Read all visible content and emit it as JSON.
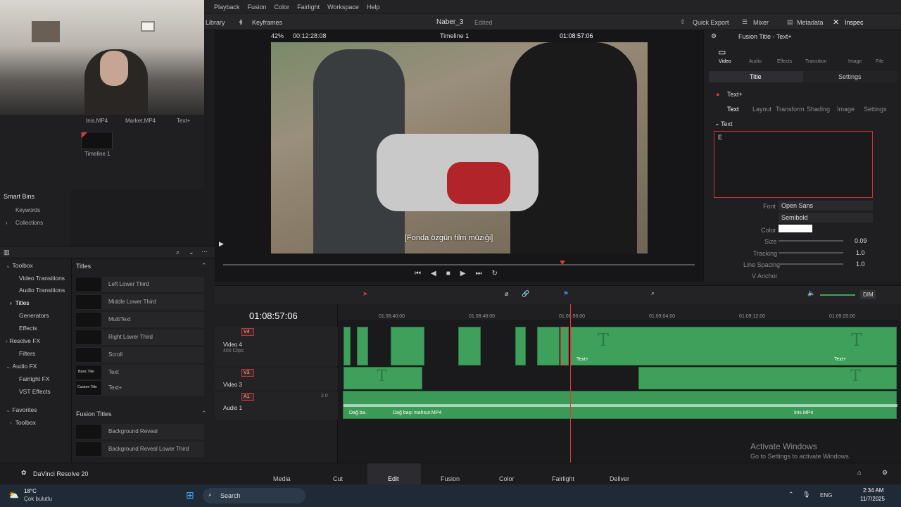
{
  "menu": [
    "Playback",
    "Fusion",
    "Color",
    "Fairlight",
    "Workspace",
    "Help"
  ],
  "toolbar": {
    "library": "Library",
    "keyframes": "Keyframes",
    "project": "Naber_3",
    "edited": "Edited",
    "quick_export": "Quick Export",
    "mixer": "Mixer",
    "metadata": "Metadata",
    "inspector": "Inspec"
  },
  "viewer_bar": {
    "zoom": "42%",
    "src_tc": "00:12:28:08",
    "timeline": "Timeline 1",
    "rec_tc": "01:08:57:06"
  },
  "video": {
    "subtitle": "[Fonda özgün film müziği]"
  },
  "media_pool": {
    "clips": [
      "Inis.MP4",
      "Market.MP4",
      "Text+"
    ],
    "timeline_clip": "Timeline 1"
  },
  "smart_bins": {
    "title": "Smart Bins",
    "items": [
      "Keywords",
      "Collections"
    ]
  },
  "fx_tree": [
    "Toolbox",
    "Video Transitions",
    "Audio Transitions",
    "Titles",
    "Generators",
    "Effects",
    "Resolve FX",
    "Filters",
    "Audio FX",
    "Fairlight FX",
    "VST Effects",
    "Favorites",
    "Toolbox"
  ],
  "titles": {
    "header": "Titles",
    "items": [
      {
        "name": "Left Lower Third",
        "thumb": "Lorem ipsum"
      },
      {
        "name": "Middle Lower Third",
        "thumb": "Lorem ipsum"
      },
      {
        "name": "MultiText",
        "thumb": "Text 1 Text 2"
      },
      {
        "name": "Right Lower Third",
        "thumb": "Lorem ipsum"
      },
      {
        "name": "Scroll",
        "thumb": "Scroll"
      },
      {
        "name": "Text",
        "thumb": "Basic Title"
      },
      {
        "name": "Text+",
        "thumb": "Custom Title"
      }
    ],
    "fusion_header": "Fusion Titles",
    "fusion_items": [
      "Background Reveal",
      "Background Reveal Lower Third"
    ]
  },
  "inspector": {
    "title": "Fusion Title - Text+",
    "tabs": [
      "Video",
      "Audio",
      "Effects",
      "Transition",
      "Image",
      "File"
    ],
    "subtabs": [
      "Title",
      "Settings"
    ],
    "node": "Text+",
    "node_tabs": [
      "Text",
      "Layout",
      "Transform",
      "Shading",
      "Image",
      "Settings"
    ],
    "section": "Text",
    "text_value": "E",
    "font_label": "Font",
    "font_value": "Open Sans",
    "style_value": "Semibold",
    "color_label": "Color",
    "size_label": "Size",
    "size_value": "0.09",
    "tracking_label": "Tracking",
    "tracking_value": "1.0",
    "line_spacing_label": "Line Spacing",
    "line_spacing_value": "1.0",
    "vanchor_label": "V Anchor"
  },
  "timeline": {
    "timecode": "01:08:57:06",
    "ruler": [
      "01:08:40:00",
      "01:08:48:00",
      "01:08:56:00",
      "01:09:04:00",
      "01:09:12:00",
      "01:09:20:00"
    ],
    "tracks": [
      {
        "id": "V4",
        "name": "Video 4",
        "info": "400 Clips"
      },
      {
        "id": "V3",
        "name": "Video 3",
        "info": ""
      },
      {
        "id": "A1",
        "name": "Audio 1",
        "info": "2.0"
      }
    ],
    "clip_labels": [
      "Text+",
      "Text+",
      "Dağ ba..",
      "Dağ başı mahsur.MP4",
      "Inis.MP4"
    ],
    "dim": "DIM"
  },
  "watermark": {
    "title": "Activate Windows",
    "sub": "Go to Settings to activate Windows."
  },
  "pages": {
    "app": "DaVinci Resolve 20",
    "items": [
      "Media",
      "Cut",
      "Edit",
      "Fusion",
      "Color",
      "Fairlight",
      "Deliver"
    ],
    "active": "Edit"
  },
  "taskbar": {
    "temp": "18°C",
    "weather": "Çok bulutlu",
    "search": "Search",
    "lang": "ENG",
    "time": "2:34 AM",
    "date": "11/7/2025"
  }
}
